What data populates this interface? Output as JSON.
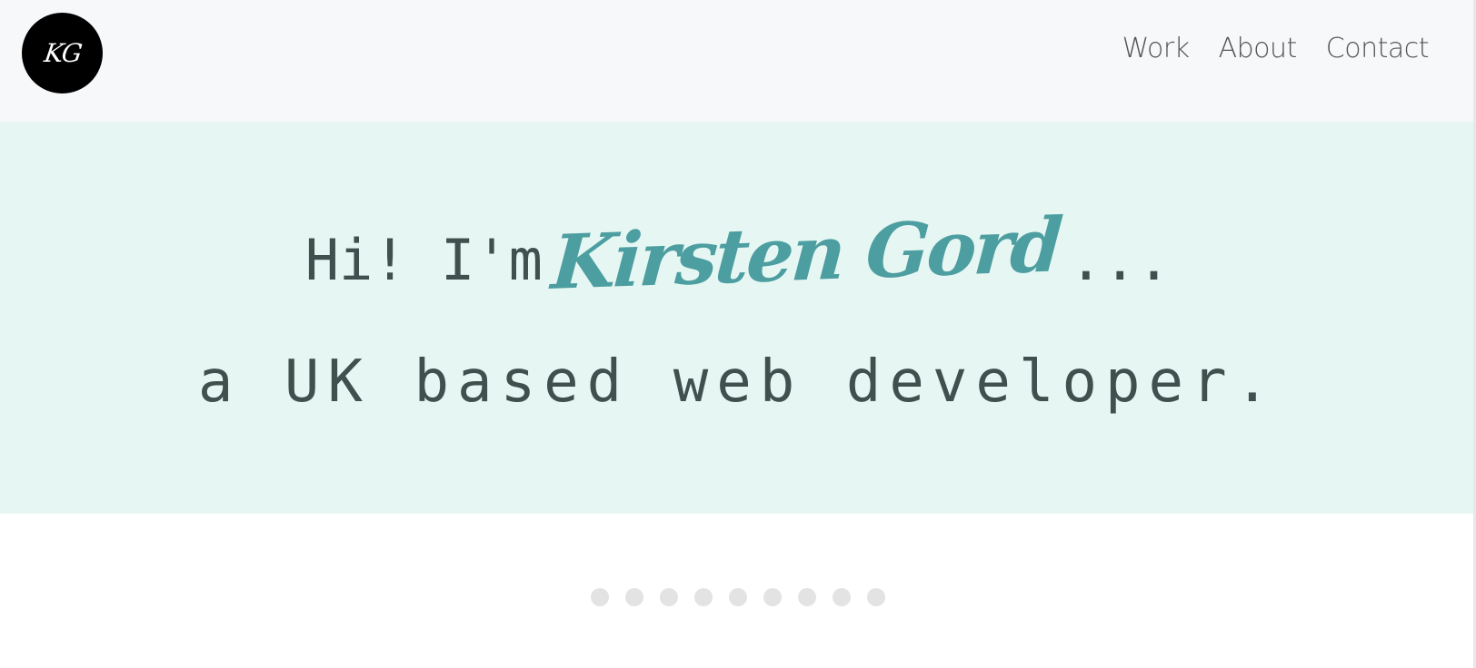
{
  "header": {
    "logo_text": "KG",
    "nav": [
      {
        "label": "Work"
      },
      {
        "label": "About"
      },
      {
        "label": "Contact"
      }
    ]
  },
  "hero": {
    "greeting": "Hi! I'm",
    "name": "Kirsten Gord",
    "ellipsis": "...",
    "tagline": "a UK based web developer."
  },
  "carousel": {
    "dot_count": 9,
    "colors": {
      "dot": "#e3e3e3"
    }
  },
  "colors": {
    "header_bg": "#f7f8fa",
    "hero_bg": "#e6f7f3",
    "text": "#3f504e",
    "accent": "#4d9ea1"
  }
}
